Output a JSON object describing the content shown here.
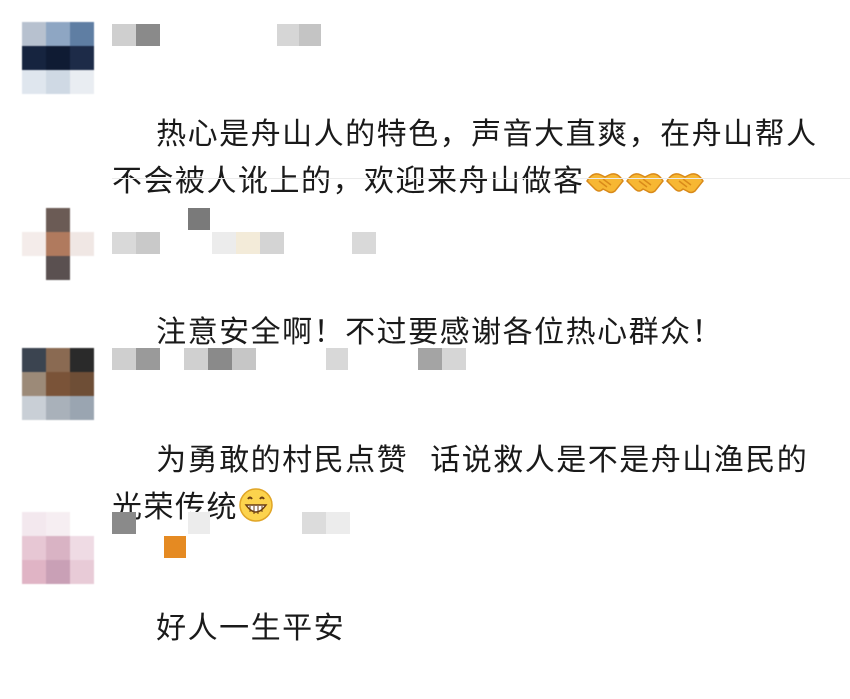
{
  "comments": [
    {
      "text": "热心是舟山人的特色，声音大直爽，在舟山帮人不会被人讹上的，欢迎来舟山做客",
      "emoji": [
        "handshake-icon",
        "handshake-icon",
        "handshake-icon"
      ]
    },
    {
      "text": "注意安全啊！不过要感谢各位热心群众！",
      "emoji": []
    },
    {
      "text": "为勇敢的村民点赞  话说救人是不是舟山渔民的光荣传统",
      "emoji": [
        "grinning-face-icon"
      ]
    },
    {
      "text": "好人一生平安",
      "emoji": []
    }
  ],
  "colors": {
    "text": "#1a1a1a",
    "divider": "#ebebeb",
    "mosaic_gray": "#b8b8b8",
    "mosaic_orange": "#e58a22"
  }
}
